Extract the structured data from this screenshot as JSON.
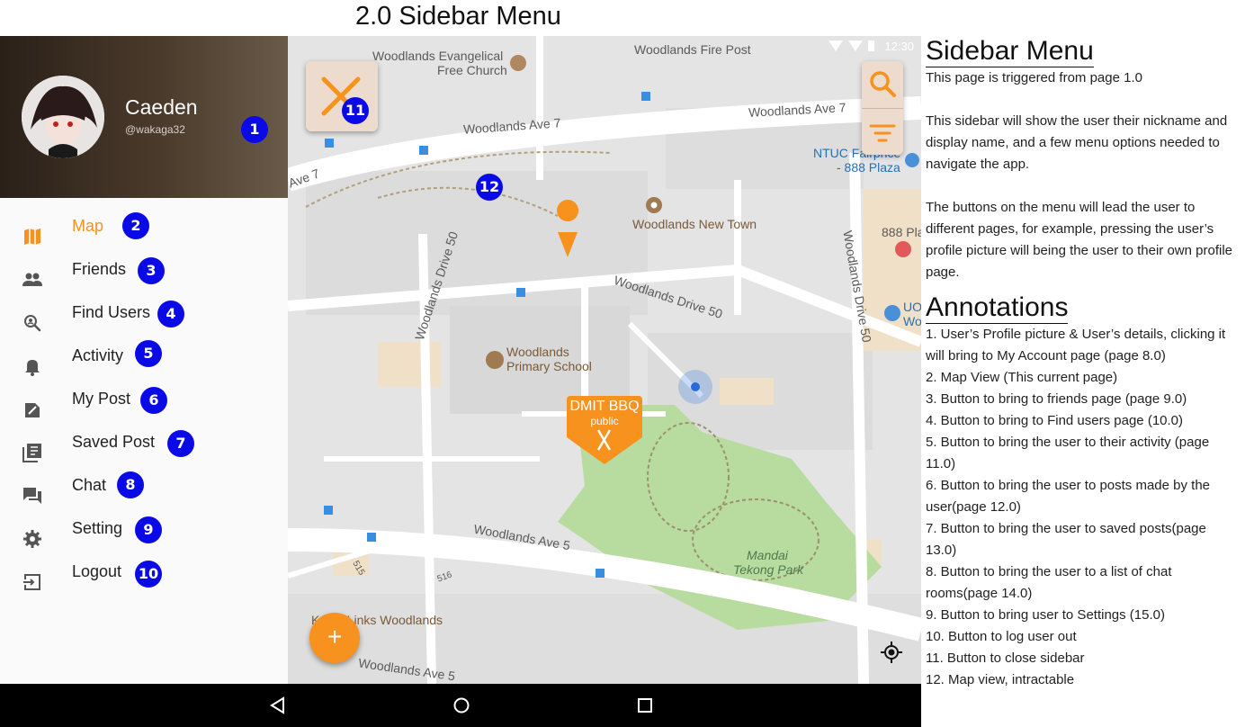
{
  "page_title": "2.0 Sidebar Menu",
  "status_bar": {
    "time": "12:30"
  },
  "profile": {
    "nickname": "Caeden",
    "handle": "@wakaga32"
  },
  "menu": [
    {
      "id": "map",
      "label": "Map",
      "icon": "map-icon",
      "active": true,
      "badge": "2"
    },
    {
      "id": "friends",
      "label": "Friends",
      "icon": "people-icon",
      "active": false,
      "badge": "3"
    },
    {
      "id": "find-users",
      "label": "Find Users",
      "icon": "person-search-icon",
      "active": false,
      "badge": "4"
    },
    {
      "id": "activity",
      "label": "Activity",
      "icon": "bell-icon",
      "active": false,
      "badge": "5"
    },
    {
      "id": "my-post",
      "label": "My Post",
      "icon": "edit-note-icon",
      "active": false,
      "badge": "6"
    },
    {
      "id": "saved-post",
      "label": "Saved Post",
      "icon": "library-books-icon",
      "active": false,
      "badge": "7"
    },
    {
      "id": "chat",
      "label": "Chat",
      "icon": "forum-icon",
      "active": false,
      "badge": "8"
    },
    {
      "id": "setting",
      "label": "Setting",
      "icon": "gear-icon",
      "active": false,
      "badge": "9"
    },
    {
      "id": "logout",
      "label": "Logout",
      "icon": "logout-icon",
      "active": false,
      "badge": "10"
    }
  ],
  "badges": {
    "profile": "1",
    "close": "11",
    "map": "12"
  },
  "map": {
    "labels": {
      "fire_post": "Woodlands Fire Post",
      "church_1": "Woodlands Evangelical",
      "church_2": "Free Church",
      "ave7_a": "Woodlands Ave 7",
      "ave7_b": "Woodlands Ave 7",
      "ave7_c": "Ave 7",
      "ntuc_1": "NTUC Fairprice",
      "ntuc_2": "- 888 Plaza",
      "new_town": "Woodlands New Town",
      "plaza_888": "888 Pla",
      "drive50_a": "Woodlands Drive 50",
      "drive50_b": "Woodlands Drive 50",
      "drive50_c": "Woodlands Drive 50",
      "school_1": "Woodlands",
      "school_2": "Primary School",
      "uob_1": "UO",
      "uob_2": "Wo",
      "ave5": "Woodlands Ave 5",
      "park_1": "Mandai",
      "park_2": "Tekong Park",
      "links": "Kranji Links Woodlands",
      "ave5_bottom": "Woodlands Ave 5",
      "blk515": "515",
      "blk516": "516"
    },
    "event": {
      "title": "DMIT BBQ",
      "subtitle": "public"
    }
  },
  "fab_label": "+",
  "notes": {
    "heading1": "Sidebar Menu",
    "intro": [
      "This page is triggered from page 1.0",
      "This sidebar will show the user their nickname and display name, and a few menu options needed to navigate the app.",
      "The buttons on the menu will lead the user to different pages, for example, pressing the user’s profile picture will being the user to their own profile page."
    ],
    "heading2": "Annotations",
    "annotations": [
      "1. User’s Profile picture & User’s details, clicking it will bring to My Account page (page 8.0)",
      "2. Map View (This current page)",
      "3. Button to bring to friends page (page 9.0)",
      "4. Button to bring to Find users page (10.0)",
      "5. Button to bring the user to their activity (page 11.0)",
      "6. Button to bring the user to posts made by the user(page 12.0)",
      "7. Button to bring the user to saved posts(page 13.0)",
      "8. Button to bring the user to a list of chat rooms(page 14.0)",
      "9. Button to bring user to Settings (15.0)",
      "10. Button to log user out",
      "11. Button to close sidebar",
      "12. Map view, intractable"
    ]
  },
  "colors": {
    "accent": "#f7921e",
    "badge": "#0a0ae6",
    "park": "#b8dca0",
    "road": "#ffffff"
  }
}
